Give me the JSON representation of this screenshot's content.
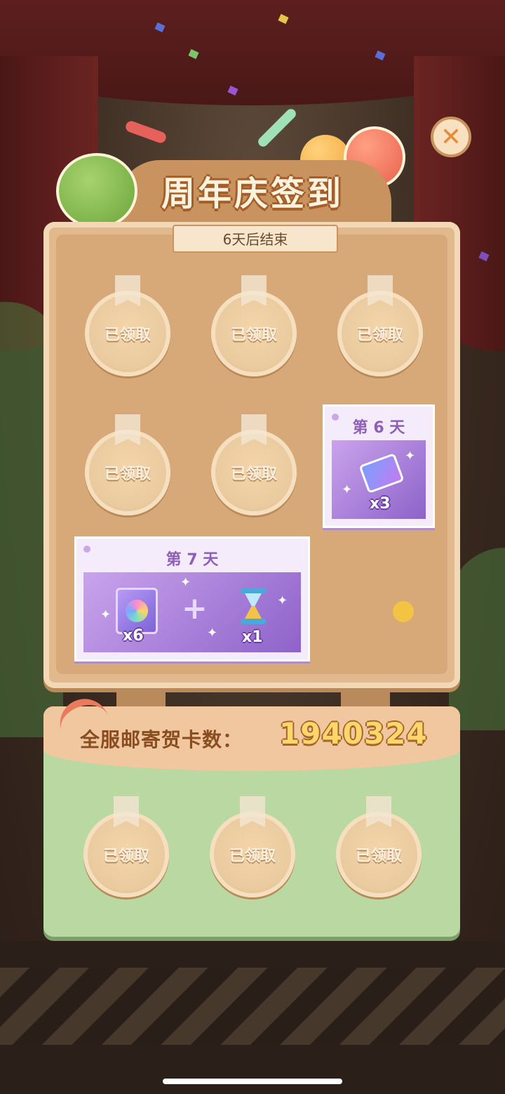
{
  "header": {
    "title": "周年庆签到",
    "countdown": "6天后结束",
    "close_icon": "✕"
  },
  "daily_rewards": [
    {
      "status": "已领取"
    },
    {
      "status": "已领取"
    },
    {
      "status": "已领取"
    },
    {
      "status": "已领取"
    },
    {
      "status": "已领取"
    },
    {
      "day_label": "第 6 天",
      "reward_qty": "x3",
      "reward_icon": "photo-card-icon"
    },
    {
      "day_label": "第 7 天",
      "rewards": [
        {
          "qty": "x6",
          "icon": "coupon-icon"
        },
        {
          "qty": "x1",
          "icon": "hourglass-icon"
        }
      ]
    }
  ],
  "server_cards": {
    "label": "全服邮寄贺卡数：",
    "count": "1940324",
    "milestones": [
      {
        "status": "已领取"
      },
      {
        "status": "已领取"
      },
      {
        "status": "已领取"
      }
    ]
  },
  "colors": {
    "board": "#e1b98d",
    "reward_purple": "#8d5fb8",
    "bottom_panel": "#b9d8a2",
    "count_gold": "#ffd66b"
  }
}
